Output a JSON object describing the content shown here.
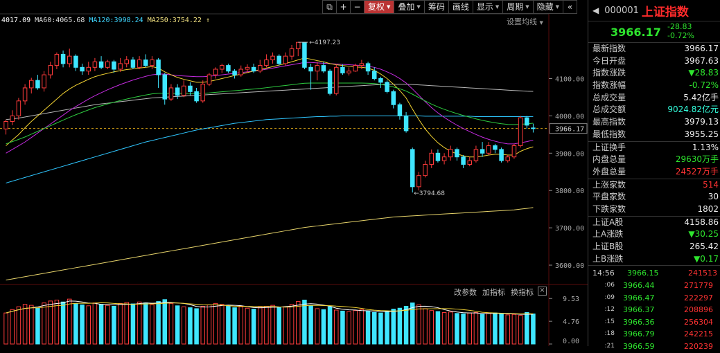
{
  "toolbar": {
    "items": [
      {
        "label": "",
        "icon": "expand-icon"
      },
      {
        "label": "+",
        "icon": "zoom-in-icon"
      },
      {
        "label": "−",
        "icon": "zoom-out-icon"
      },
      {
        "label": "复权",
        "active": true,
        "caret": true
      },
      {
        "label": "叠加",
        "caret": true
      },
      {
        "label": "筹码"
      },
      {
        "label": "画线"
      },
      {
        "label": "显示",
        "caret": true
      },
      {
        "label": "周期",
        "caret": true
      },
      {
        "label": "隐藏",
        "caret": true
      },
      {
        "label": "",
        "icon": "collapse-icon"
      }
    ]
  },
  "ma_legend": [
    {
      "text": "4017.09",
      "color": "#ffffff"
    },
    {
      "text": "MA60:4065.68",
      "color": "#e0e0e0"
    },
    {
      "text": "MA120:3998.24",
      "color": "#3fd6ff"
    },
    {
      "text": "MA250:3754.22",
      "color": "#f0e080"
    },
    {
      "text": "↑",
      "color": "#f0e080"
    }
  ],
  "settings_label": "设置均线",
  "settings_caret": "▼",
  "price_axis": {
    "ticks": [
      "4100.00",
      "4000.00",
      "3900.00",
      "3800.00",
      "3700.00",
      "3600.00"
    ],
    "current": "3966.17"
  },
  "annotations": {
    "high": "4197.23",
    "low": "3794.68"
  },
  "volume_axis": {
    "ticks": [
      "9.53",
      "4.76",
      "0.00"
    ]
  },
  "sub_controls": [
    "改参数",
    "加指标",
    "换指标"
  ],
  "sub_close": "×",
  "quote": {
    "code": "000001",
    "name": "上证指数",
    "price": "3966.17",
    "change": "-28.83",
    "change_pct": "-0.72%",
    "fields": [
      {
        "k": "最新指数",
        "v": "3966.17",
        "c": "white"
      },
      {
        "k": "今日开盘",
        "v": "3967.63",
        "c": "white"
      },
      {
        "k": "指数涨跌",
        "v": "▼28.83",
        "c": "green"
      },
      {
        "k": "指数涨幅",
        "v": "-0.72%",
        "c": "green"
      },
      {
        "k": "总成交量",
        "v": "5.42亿手",
        "c": "white"
      },
      {
        "k": "总成交额",
        "v": "9024.82亿元",
        "c": "cyan"
      },
      {
        "k": "最高指数",
        "v": "3979.13",
        "c": "white"
      },
      {
        "k": "最低指数",
        "v": "3955.25",
        "c": "white"
      },
      {
        "k": "上证换手",
        "v": "1.13%",
        "c": "white"
      },
      {
        "k": "内盘总量",
        "v": "29630万手",
        "c": "green"
      },
      {
        "k": "外盘总量",
        "v": "24527万手",
        "c": "red"
      },
      {
        "k": "上涨家数",
        "v": "514",
        "c": "red"
      },
      {
        "k": "平盘家数",
        "v": "30",
        "c": "white"
      },
      {
        "k": "下跌家数",
        "v": "1802",
        "c": "white"
      },
      {
        "k": "上证A股",
        "v": "4158.86",
        "c": "white"
      },
      {
        "k": "上A涨跌",
        "v": "▼30.25",
        "c": "green"
      },
      {
        "k": "上证B股",
        "v": "265.42",
        "c": "white"
      },
      {
        "k": "上B涨跌",
        "v": "▼0.17",
        "c": "green"
      }
    ],
    "ticks": [
      {
        "t": "14:56",
        "p": "3966.15",
        "v": "241513"
      },
      {
        "t": ":06",
        "p": "3966.44",
        "v": "271779"
      },
      {
        "t": ":09",
        "p": "3966.47",
        "v": "222297"
      },
      {
        "t": ":12",
        "p": "3966.37",
        "v": "208896"
      },
      {
        "t": ":15",
        "p": "3966.36",
        "v": "256304"
      },
      {
        "t": ":18",
        "p": "3966.79",
        "v": "242215"
      },
      {
        "t": ":21",
        "p": "3966.59",
        "v": "220239"
      }
    ]
  },
  "chart_data": {
    "type": "candlestick",
    "ylim": [
      3550,
      4240
    ],
    "candles": [
      [
        3965,
        3985,
        3950,
        3990
      ],
      [
        3985,
        4000,
        3975,
        4015
      ],
      [
        4000,
        4040,
        3990,
        4048
      ],
      [
        4040,
        4075,
        4030,
        4085
      ],
      [
        4075,
        4095,
        4060,
        4102
      ],
      [
        4095,
        4075,
        4070,
        4110
      ],
      [
        4075,
        4110,
        4065,
        4120
      ],
      [
        4110,
        4135,
        4100,
        4145
      ],
      [
        4135,
        4165,
        4125,
        4170
      ],
      [
        4165,
        4140,
        4130,
        4175
      ],
      [
        4140,
        4160,
        4130,
        4180
      ],
      [
        4160,
        4130,
        4120,
        4165
      ],
      [
        4130,
        4120,
        4110,
        4140
      ],
      [
        4120,
        4130,
        4110,
        4145
      ],
      [
        4130,
        4145,
        4120,
        4155
      ],
      [
        4145,
        4130,
        4125,
        4160
      ],
      [
        4130,
        4145,
        4125,
        4150
      ],
      [
        4145,
        4125,
        4115,
        4150
      ],
      [
        4125,
        4140,
        4118,
        4155
      ],
      [
        4140,
        4150,
        4130,
        4160
      ],
      [
        4150,
        4130,
        4125,
        4158
      ],
      [
        4130,
        4150,
        4125,
        4160
      ],
      [
        4150,
        4135,
        4130,
        4165
      ],
      [
        4135,
        4150,
        4125,
        4160
      ],
      [
        4150,
        4110,
        4075,
        4155
      ],
      [
        4110,
        4045,
        4030,
        4115
      ],
      [
        4045,
        4075,
        4040,
        4085
      ],
      [
        4075,
        4055,
        4045,
        4085
      ],
      [
        4055,
        4080,
        4050,
        4095
      ],
      [
        4080,
        4065,
        4055,
        4090
      ],
      [
        4065,
        4040,
        4035,
        4075
      ],
      [
        4040,
        4085,
        4035,
        4095
      ],
      [
        4085,
        4110,
        4080,
        4115
      ],
      [
        4110,
        4125,
        4100,
        4130
      ],
      [
        4125,
        4135,
        4115,
        4140
      ],
      [
        4135,
        4120,
        4115,
        4140
      ],
      [
        4120,
        4110,
        4100,
        4125
      ],
      [
        4110,
        4125,
        4105,
        4135
      ],
      [
        4125,
        4130,
        4115,
        4138
      ],
      [
        4130,
        4120,
        4115,
        4140
      ],
      [
        4120,
        4135,
        4115,
        4150
      ],
      [
        4135,
        4150,
        4130,
        4165
      ],
      [
        4150,
        4160,
        4140,
        4170
      ],
      [
        4160,
        4140,
        4135,
        4165
      ],
      [
        4140,
        4160,
        4135,
        4170
      ],
      [
        4160,
        4180,
        4150,
        4190
      ],
      [
        4180,
        4197,
        4160,
        4197.23
      ],
      [
        4197,
        4130,
        4125,
        4197
      ],
      [
        4130,
        4120,
        4070,
        4140
      ],
      [
        4120,
        4135,
        4095,
        4145
      ],
      [
        4135,
        4120,
        4115,
        4145
      ],
      [
        4120,
        4060,
        4055,
        4125
      ],
      [
        4060,
        4130,
        4055,
        4138
      ],
      [
        4130,
        4115,
        4110,
        4138
      ],
      [
        4115,
        4120,
        4108,
        4130
      ],
      [
        4120,
        4135,
        4118,
        4140
      ],
      [
        4135,
        4140,
        4125,
        4150
      ],
      [
        4140,
        4120,
        4110,
        4145
      ],
      [
        4120,
        4100,
        4095,
        4130
      ],
      [
        4100,
        4090,
        4075,
        4105
      ],
      [
        4090,
        4065,
        4060,
        4095
      ],
      [
        4065,
        4030,
        4020,
        4070
      ],
      [
        4030,
        4000,
        3990,
        4035
      ],
      [
        4000,
        3960,
        3955,
        4010
      ],
      [
        3910,
        3810,
        3794.68,
        3915
      ],
      [
        3810,
        3840,
        3800,
        3850
      ],
      [
        3840,
        3870,
        3835,
        3880
      ],
      [
        3870,
        3900,
        3860,
        3910
      ],
      [
        3900,
        3880,
        3875,
        3910
      ],
      [
        3880,
        3890,
        3870,
        3900
      ],
      [
        3890,
        3910,
        3880,
        3920
      ],
      [
        3910,
        3890,
        3880,
        3915
      ],
      [
        3890,
        3870,
        3860,
        3895
      ],
      [
        3870,
        3880,
        3865,
        3890
      ],
      [
        3880,
        3910,
        3875,
        3920
      ],
      [
        3910,
        3900,
        3890,
        3930
      ],
      [
        3900,
        3920,
        3895,
        3930
      ],
      [
        3920,
        3910,
        3900,
        3925
      ],
      [
        3910,
        3880,
        3875,
        3915
      ],
      [
        3880,
        3890,
        3875,
        3895
      ],
      [
        3890,
        3920,
        3885,
        3925
      ],
      [
        3920,
        3995,
        3915,
        4000
      ],
      [
        3995,
        3975,
        3965,
        4000
      ],
      [
        3967.63,
        3966.17,
        3955.25,
        3979.13
      ]
    ],
    "ma60": [
      3990,
      3992,
      3994,
      3997,
      4000,
      4003,
      4006,
      4009,
      4012,
      4015,
      4018,
      4021,
      4024,
      4027,
      4030,
      4032,
      4034,
      4036,
      4038,
      4040,
      4042,
      4044,
      4046,
      4048,
      4049,
      4050,
      4051,
      4052,
      4053,
      4054,
      4055,
      4056,
      4057,
      4058,
      4059,
      4060,
      4061,
      4062,
      4063,
      4064,
      4065,
      4066,
      4067,
      4068,
      4069,
      4070,
      4071,
      4072,
      4073,
      4074,
      4075,
      4076,
      4077,
      4078,
      4079,
      4080,
      4081,
      4082,
      4083,
      4084,
      4085,
      4085,
      4085,
      4085,
      4084,
      4083,
      4082,
      4081,
      4080,
      4079,
      4078,
      4077,
      4076,
      4075,
      4074,
      4073,
      4072,
      4071,
      4070,
      4069,
      4068,
      4067,
      4066,
      4065.68
    ],
    "ma120": [
      3820,
      3825,
      3830,
      3835,
      3840,
      3845,
      3850,
      3855,
      3860,
      3865,
      3870,
      3875,
      3880,
      3885,
      3890,
      3895,
      3900,
      3905,
      3910,
      3915,
      3920,
      3925,
      3930,
      3934,
      3938,
      3942,
      3946,
      3950,
      3954,
      3958,
      3962,
      3965,
      3968,
      3971,
      3974,
      3977,
      3980,
      3982,
      3984,
      3986,
      3988,
      3990,
      3991,
      3992,
      3993,
      3994,
      3995,
      3996,
      3997,
      3998,
      3998,
      3999,
      3999,
      4000,
      4000,
      4000,
      4000,
      4000,
      4000,
      4000,
      4000,
      4000,
      4000,
      4000,
      4000,
      4000,
      3999,
      3999,
      3999,
      3999,
      3999,
      3999,
      3999,
      3999,
      3998,
      3998,
      3998,
      3998,
      3998,
      3998,
      3998,
      3998,
      3998,
      3998.24
    ],
    "ma250": [
      3560,
      3563,
      3566,
      3569,
      3572,
      3575,
      3578,
      3581,
      3584,
      3587,
      3590,
      3593,
      3596,
      3599,
      3602,
      3605,
      3608,
      3611,
      3614,
      3617,
      3620,
      3623,
      3626,
      3629,
      3632,
      3635,
      3638,
      3641,
      3644,
      3647,
      3650,
      3653,
      3656,
      3659,
      3662,
      3665,
      3668,
      3671,
      3674,
      3677,
      3680,
      3683,
      3686,
      3689,
      3692,
      3695,
      3698,
      3701,
      3703,
      3705,
      3707,
      3709,
      3711,
      3713,
      3715,
      3717,
      3719,
      3721,
      3723,
      3725,
      3727,
      3729,
      3730,
      3731,
      3732,
      3733,
      3734,
      3735,
      3736,
      3737,
      3738,
      3739,
      3740,
      3741,
      3742,
      3743,
      3744,
      3745,
      3746,
      3747,
      3748,
      3750,
      3752,
      3754.22
    ],
    "ma_short": [
      3920,
      3935,
      3950,
      3968,
      3985,
      4000,
      4015,
      4030,
      4045,
      4060,
      4072,
      4082,
      4090,
      4098,
      4105,
      4110,
      4114,
      4118,
      4121,
      4124,
      4126,
      4128,
      4130,
      4132,
      4128,
      4118,
      4110,
      4103,
      4098,
      4094,
      4090,
      4090,
      4092,
      4096,
      4100,
      4104,
      4108,
      4112,
      4116,
      4120,
      4124,
      4128,
      4132,
      4136,
      4140,
      4145,
      4150,
      4155,
      4152,
      4148,
      4145,
      4140,
      4137,
      4135,
      4133,
      4131,
      4130,
      4128,
      4122,
      4112,
      4100,
      4085,
      4068,
      4048,
      4018,
      3990,
      3965,
      3945,
      3928,
      3915,
      3905,
      3898,
      3893,
      3890,
      3890,
      3892,
      3895,
      3897,
      3897,
      3895,
      3895,
      3905,
      3912,
      3917
    ],
    "ma_mid": [
      3900,
      3910,
      3920,
      3930,
      3942,
      3954,
      3966,
      3978,
      3990,
      4002,
      4014,
      4025,
      4035,
      4045,
      4054,
      4062,
      4070,
      4077,
      4084,
      4090,
      4096,
      4101,
      4106,
      4110,
      4112,
      4112,
      4110,
      4108,
      4107,
      4106,
      4105,
      4105,
      4106,
      4108,
      4110,
      4112,
      4114,
      4116,
      4118,
      4120,
      4122,
      4125,
      4128,
      4131,
      4134,
      4137,
      4140,
      4143,
      4143,
      4142,
      4141,
      4140,
      4139,
      4138,
      4137,
      4136,
      4135,
      4133,
      4130,
      4125,
      4118,
      4110,
      4100,
      4088,
      4072,
      4055,
      4038,
      4022,
      4008,
      3996,
      3985,
      3975,
      3966,
      3958,
      3950,
      3943,
      3937,
      3932,
      3928,
      3925,
      3925,
      3928,
      3931,
      3935
    ]
  },
  "volume_data": {
    "ylim": [
      0,
      10
    ],
    "values": [
      6.5,
      7.2,
      7.8,
      8.3,
      8.1,
      7.5,
      8.6,
      9.0,
      9.2,
      8.8,
      9.4,
      8.4,
      8.2,
      8.0,
      8.6,
      8.3,
      8.1,
      7.9,
      8.5,
      8.7,
      8.4,
      8.8,
      8.6,
      8.2,
      8.9,
      9.3,
      8.5,
      8.0,
      7.8,
      7.6,
      7.4,
      7.9,
      8.2,
      8.5,
      8.3,
      7.9,
      7.6,
      7.8,
      7.5,
      7.3,
      7.7,
      7.9,
      8.1,
      7.6,
      7.8,
      8.3,
      8.9,
      9.2,
      8.0,
      7.4,
      7.2,
      7.8,
      7.1,
      6.9,
      6.8,
      7.0,
      7.2,
      6.9,
      6.6,
      6.5,
      6.8,
      7.3,
      7.5,
      7.9,
      8.6,
      8.2,
      7.4,
      7.0,
      6.8,
      6.6,
      6.7,
      6.4,
      6.3,
      6.5,
      6.6,
      6.2,
      6.4,
      6.5,
      6.3,
      6.1,
      6.2,
      6.0,
      6.6,
      6.3
    ]
  }
}
